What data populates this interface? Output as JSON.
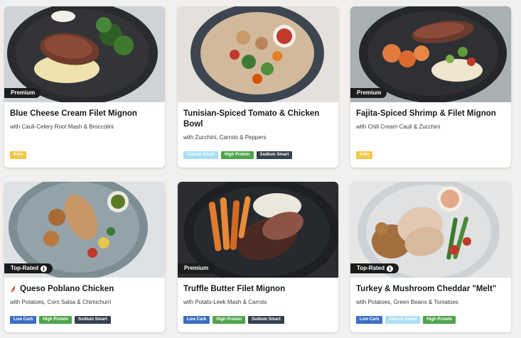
{
  "colors": {
    "keto": "#f2c744",
    "calorie_smart": "#a9dff4",
    "high_protein": "#4fa44b",
    "sodium_smart": "#34414f",
    "low_carb": "#3a6fc4",
    "flag_bg": "#1c1c1c"
  },
  "meals": [
    {
      "flag": "Premium",
      "title": "Blue Cheese Cream Filet Mignon",
      "subtitle": "with Cauli-Celery Root Mash & Broccolini",
      "tags": [
        "Keto"
      ]
    },
    {
      "flag": "",
      "title": "Tunisian-Spiced Tomato & Chicken Bowl",
      "subtitle": "with Zucchini, Carrots & Peppers",
      "tags": [
        "Calorie Smart",
        "High Protein",
        "Sodium Smart"
      ]
    },
    {
      "flag": "Premium",
      "title": "Fajita-Spiced Shrimp & Filet Mignon",
      "subtitle": "with Chili Cream Cauli & Zucchini",
      "tags": [
        "Keto"
      ]
    },
    {
      "flag": "Top-Rated",
      "title": "Queso Poblano Chicken",
      "title_icon": "chili-pepper-icon",
      "subtitle": "with Potatoes, Corn Salsa & Chimichurri",
      "tags": [
        "Low Carb",
        "High Protein",
        "Sodium Smart"
      ]
    },
    {
      "flag": "Premium",
      "title": "Truffle Butter Filet Mignon",
      "subtitle": "with Potato-Leek Mash & Carrots",
      "tags": [
        "Low Carb",
        "High Protein",
        "Sodium Smart"
      ]
    },
    {
      "flag": "Top-Rated",
      "title": "Turkey & Mushroom Cheddar \"Melt\"",
      "subtitle": "with Potatoes, Green Beans & Tomatoes",
      "tags": [
        "Low Carb",
        "Calorie Smart",
        "High Protein"
      ]
    }
  ]
}
